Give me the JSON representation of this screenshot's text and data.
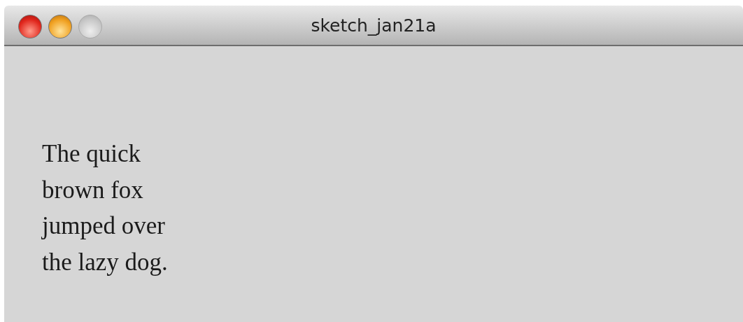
{
  "window": {
    "title": "sketch_jan21a",
    "controls": [
      {
        "kind": "close",
        "disabled": false
      },
      {
        "kind": "minimize",
        "disabled": false
      },
      {
        "kind": "zoom",
        "disabled": true
      }
    ]
  },
  "text": {
    "lines": [
      "The quick",
      "brown fox",
      "jumped over",
      "the lazy dog."
    ]
  }
}
